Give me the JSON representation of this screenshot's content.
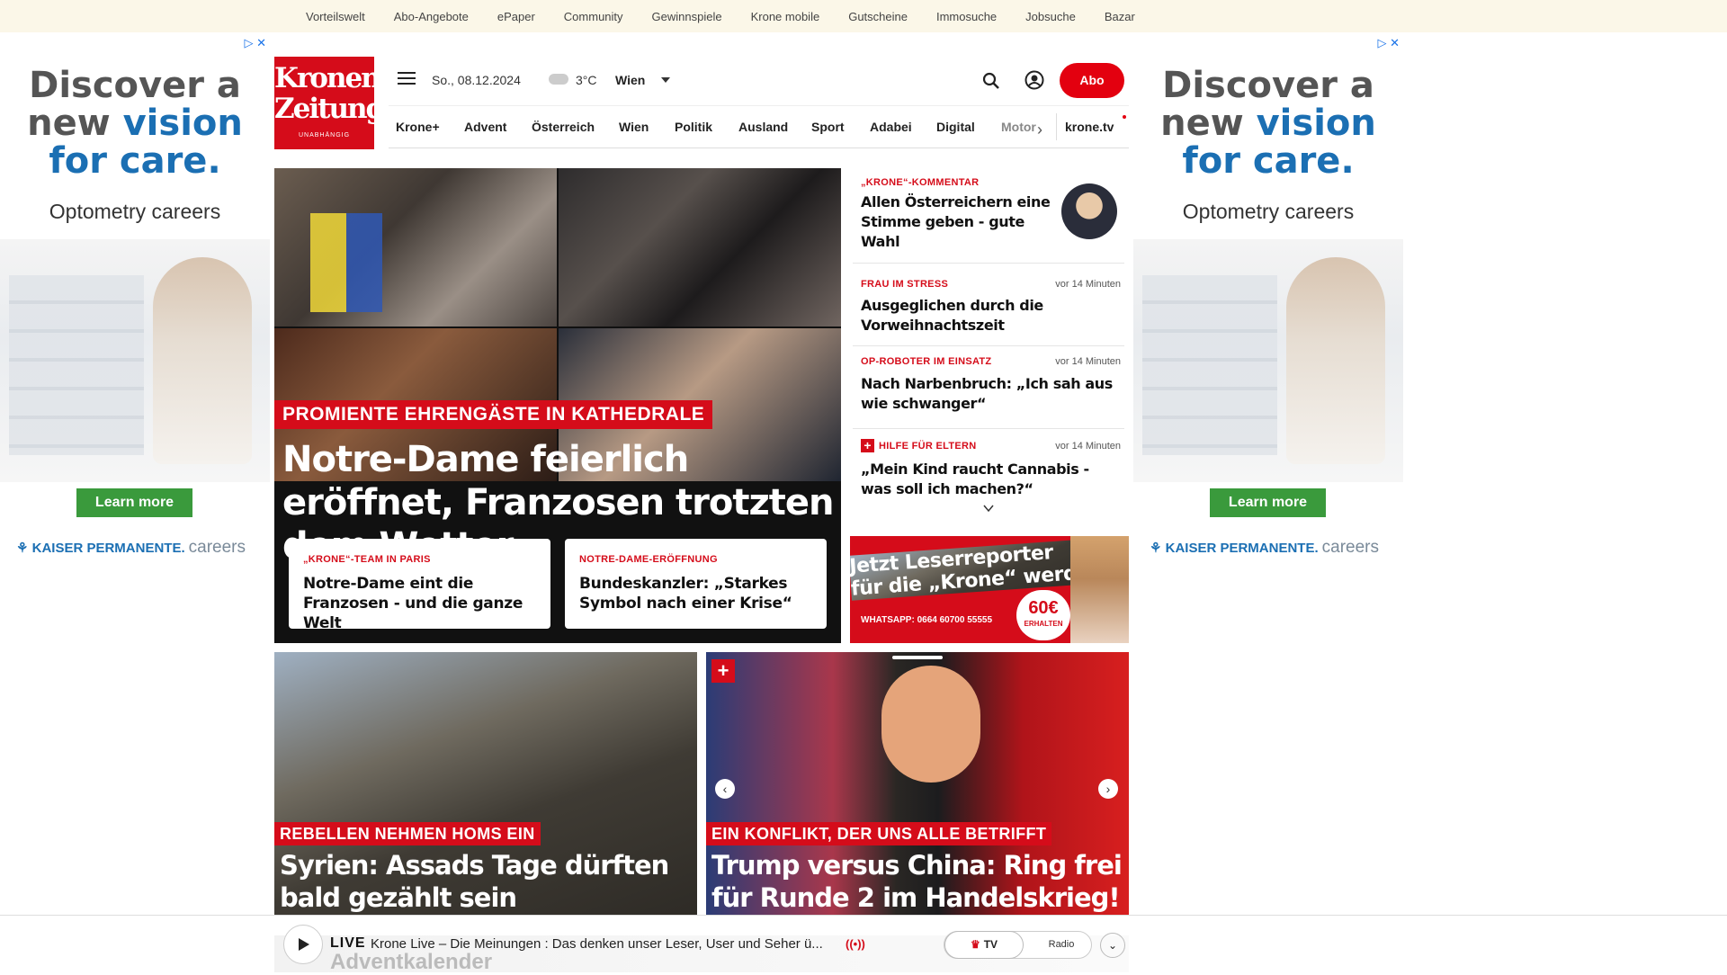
{
  "topbar": {
    "links": [
      "Vorteilswelt",
      "Abo-Angebote",
      "ePaper",
      "Community",
      "Gewinnspiele",
      "Krone mobile",
      "Gutscheine",
      "Immosuche",
      "Jobsuche",
      "Bazar"
    ]
  },
  "ad": {
    "headline_1": "Discover a",
    "headline_2": "new",
    "headline_vision": "vision",
    "headline_3": "for care.",
    "sub": "Optometry careers",
    "cta": "Learn more",
    "brand": "KAISER PERMANENTE.",
    "brand_careers": "careers"
  },
  "logo": {
    "line1": "Kronen",
    "line2": "Zeitung",
    "line3": "UNABHÄNGIG"
  },
  "header": {
    "date": "So., 08.12.2024",
    "temperature": "3°C",
    "city": "Wien",
    "abo_label": "Abo"
  },
  "nav": {
    "items": [
      "Krone+",
      "Advent",
      "Österreich",
      "Wien",
      "Politik",
      "Ausland",
      "Sport",
      "Adabei",
      "Digital",
      "Motor"
    ],
    "krone_tv": "krone.tv"
  },
  "hero": {
    "kicker": "PROMIENTE EHRENGÄSTE IN KATHEDRALE",
    "title": "Notre-Dame feierlich eröffnet, Franzosen trotzten dem Wetter",
    "cards": [
      {
        "kicker": "„KRONE“-TEAM IN PARIS",
        "title": "Notre-Dame eint die Franzosen - und die ganze Welt"
      },
      {
        "kicker": "NOTRE-DAME-ERÖFFNUNG",
        "title": "Bundeskanzler: „Starkes Symbol nach einer Krise“"
      }
    ]
  },
  "sidebar": {
    "items": [
      {
        "kicker": "„KRONE“-KOMMENTAR",
        "title": "Allen Österreichern eine Stimme geben - gute Wahl",
        "time": ""
      },
      {
        "kicker": "FRAU IM STRESS",
        "title": "Ausgeglichen durch die Vorweihnachtszeit",
        "time": "vor 14 Minuten"
      },
      {
        "kicker": "OP-ROBOTER IM EINSATZ",
        "title": "Nach Narbenbruch: „Ich sah aus wie schwanger“",
        "time": "vor 14 Minuten"
      },
      {
        "kicker": "HILFE FÜR ELTERN",
        "title": "„Mein Kind raucht Cannabis - was soll ich machen?“",
        "time": "vor 14 Minuten"
      }
    ]
  },
  "promo": {
    "line1": "Jetzt Leserreporter",
    "line2": "für die „Krone“ werden",
    "whatsapp": "WHATSAPP: 0664 60700 55555",
    "amount": "60€",
    "amount_sub": "ERHALTEN"
  },
  "teasers": [
    {
      "kicker": "REBELLEN NEHMEN HOMS EIN",
      "title": "Syrien: Assads Tage dürften bald gezählt sein"
    },
    {
      "kicker": "EIN KONFLIKT, DER UNS ALLE BETRIFFT",
      "title": "Trump versus China: Ring frei für Runde 2 im Handelskrieg!"
    }
  ],
  "player": {
    "live": "LIVE",
    "title": "Krone Live – Die Meinungen : Das denken unser Leser, User und Seher ü...",
    "tv": "TV",
    "radio": "Radio",
    "advent": "Adventkalender"
  }
}
